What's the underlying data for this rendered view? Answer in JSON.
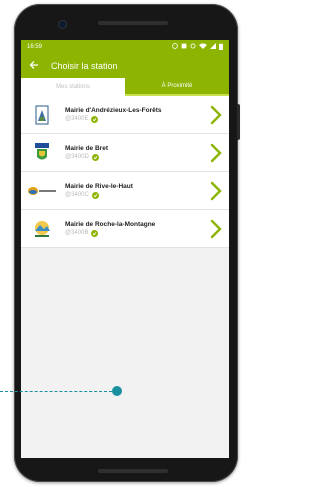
{
  "status_bar": {
    "time": "16:59"
  },
  "header": {
    "title": "Choisir la station"
  },
  "tabs": [
    {
      "label": "Mes stations",
      "active": false
    },
    {
      "label": "À Proximité",
      "active": true
    }
  ],
  "stations": [
    {
      "name": "Mairie d'Andrézieux-Les-Forêts",
      "code": "@3400E",
      "logo": "andrezieux-logo"
    },
    {
      "name": "Mairie de Bret",
      "code": "@3400D",
      "logo": "bret-logo"
    },
    {
      "name": "Mairie de Rive-le-Haut",
      "code": "@3400C",
      "logo": "rive-le-haut-logo"
    },
    {
      "name": "Mairie de Roche-la-Montagne",
      "code": "@3400B",
      "logo": "roche-la-montagne-logo"
    }
  ],
  "colors": {
    "accent": "#8cb400",
    "callout": "#1a8fa0"
  }
}
